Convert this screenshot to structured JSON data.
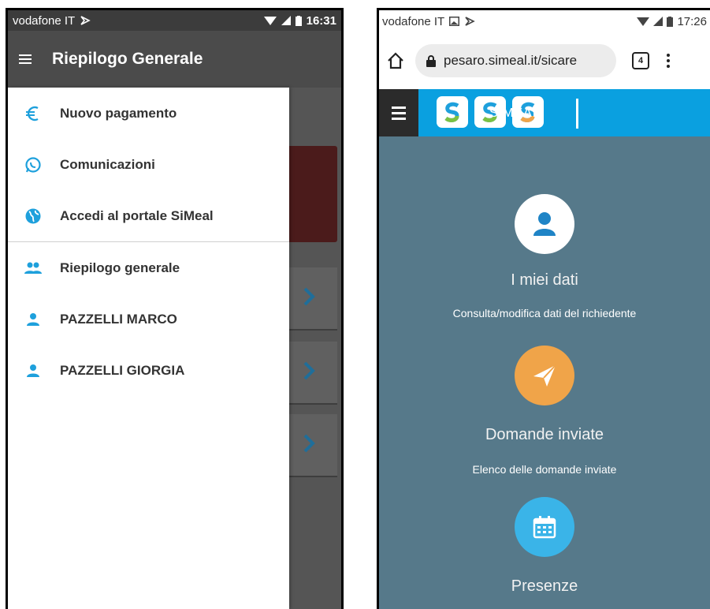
{
  "left": {
    "status": {
      "carrier": "vodafone IT",
      "time": "16:31"
    },
    "appbar": {
      "title": "Riepilogo Generale"
    },
    "drawer": {
      "top_items": [
        {
          "label": "Nuovo pagamento",
          "icon": "euro-icon"
        },
        {
          "label": "Comunicazioni",
          "icon": "whatsapp-icon"
        },
        {
          "label": "Accedi al portale SiMeal",
          "icon": "globe-icon"
        }
      ],
      "bottom_items": [
        {
          "label": "Riepilogo generale",
          "icon": "people-icon"
        },
        {
          "label": "PAZZELLI MARCO",
          "icon": "person-icon"
        },
        {
          "label": "PAZZELLI GIORGIA",
          "icon": "person-icon"
        }
      ]
    }
  },
  "right": {
    "status": {
      "carrier": "vodafone IT",
      "time": "17:26"
    },
    "browser": {
      "url": "pesaro.simeal.it/sicare",
      "tab_count": "4"
    },
    "header": {
      "logo_text": "SIMEAL"
    },
    "tiles": [
      {
        "title": "I miei dati",
        "desc": "Consulta/modifica dati del richiedente",
        "color": "#ffffff"
      },
      {
        "title": "Domande inviate",
        "desc": "Elenco delle domande inviate",
        "color": "#f0a449"
      },
      {
        "title": "Presenze",
        "desc": "",
        "color": "#3ab4e8"
      }
    ]
  },
  "colors": {
    "accent_blue": "#1ea0dc",
    "header_blue": "#0aa0e0",
    "page_bg": "#56798a"
  }
}
